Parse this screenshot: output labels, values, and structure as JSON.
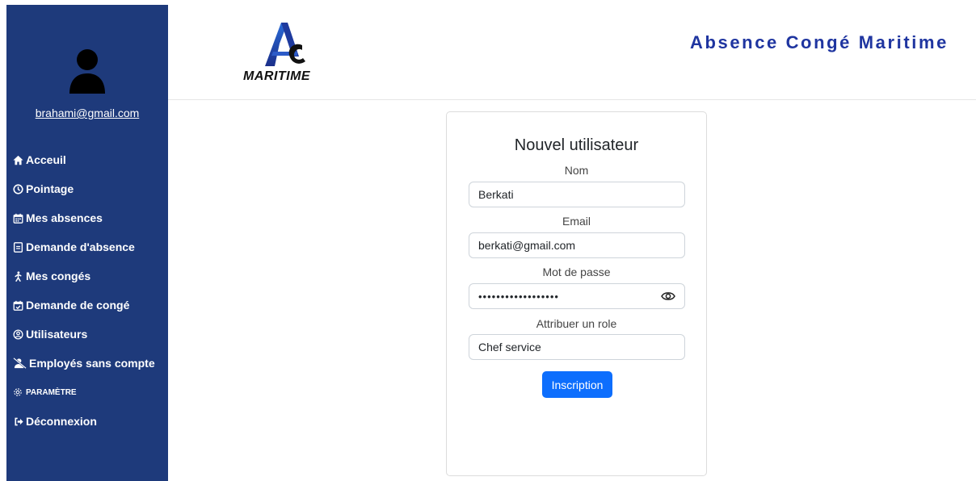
{
  "app": {
    "title": "Absence Congé Maritime",
    "logo_text": "MARITIME"
  },
  "sidebar": {
    "user_email": "brahami@gmail.com",
    "items": [
      {
        "label": "Acceuil",
        "icon": "home-icon"
      },
      {
        "label": "Pointage",
        "icon": "clock-icon"
      },
      {
        "label": "Mes absences",
        "icon": "calendar-icon"
      },
      {
        "label": "Demande d'absence",
        "icon": "document-icon"
      },
      {
        "label": "Mes congés",
        "icon": "person-walking-icon"
      },
      {
        "label": "Demande de congé",
        "icon": "calendar-check-icon"
      },
      {
        "label": "Utilisateurs",
        "icon": "user-circle-icon"
      },
      {
        "label": "Employés sans compte",
        "icon": "user-slash-icon"
      }
    ],
    "settings_label": "PARAMÈTRE",
    "logout_label": "Déconnexion"
  },
  "form": {
    "title": "Nouvel utilisateur",
    "nom_label": "Nom",
    "nom_value": "Berkati",
    "email_label": "Email",
    "email_value": "berkati@gmail.com",
    "password_label": "Mot de passe",
    "password_mask": "••••••••••••••••••",
    "role_label": "Attribuer un role",
    "role_value": "Chef service",
    "submit_label": "Inscription"
  },
  "colors": {
    "sidebar_bg": "#1e3a7b",
    "title": "#1f35a0",
    "primary_button": "#0d6efd"
  }
}
